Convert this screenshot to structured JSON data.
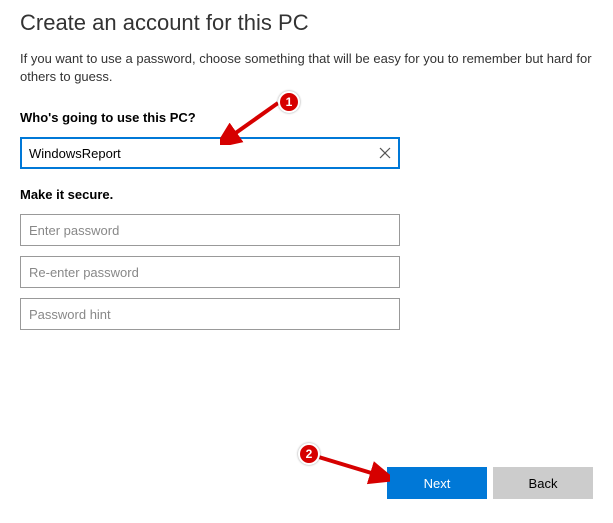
{
  "title": "Create an account for this PC",
  "description": "If you want to use a password, choose something that will be easy for you to remember but hard for others to guess.",
  "username_section": {
    "label": "Who's going to use this PC?",
    "value": "WindowsReport"
  },
  "secure_section": {
    "label": "Make it secure.",
    "password_placeholder": "Enter password",
    "reenter_placeholder": "Re-enter password",
    "hint_placeholder": "Password hint"
  },
  "buttons": {
    "next": "Next",
    "back": "Back"
  },
  "annotations": {
    "badge1": "1",
    "badge2": "2"
  }
}
